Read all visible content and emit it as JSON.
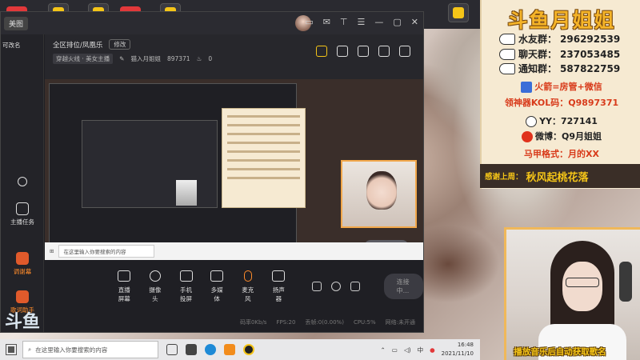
{
  "outer": {
    "top_tab": "美图",
    "left_label": "可改名",
    "sidebar": {
      "host_task": "主播任务",
      "volume_lottery": "调谢幕",
      "song_helper": "歌词助手"
    },
    "logo_text": "斗鱼"
  },
  "window": {
    "room_category": "全区排位/凤凰乐",
    "edit_label": "修改",
    "room_subtitle": "穿越火线 · 美女主播",
    "room_owner": "猫入月姐姐",
    "room_id": "897371",
    "heat": "0",
    "preview_nested_caption": "预览中",
    "start_button": "连接中..."
  },
  "controls": [
    {
      "label": "直播屏幕",
      "icon": "monitor-icon"
    },
    {
      "label": "摄像头",
      "icon": "camera-icon"
    },
    {
      "label": "手机投屏",
      "icon": "phone-icon"
    },
    {
      "label": "多媒体",
      "icon": "media-icon"
    },
    {
      "label": "麦克风",
      "icon": "microphone-icon"
    },
    {
      "label": "扬声器",
      "icon": "speaker-icon"
    }
  ],
  "status": {
    "bitrate": "码率0Kb/s",
    "fps": "FPS:20",
    "drop": "丢帧:0(0.00%)",
    "cpu": "CPU:5%",
    "network": "网络:未开通"
  },
  "taskbar": {
    "search_placeholder": "在这里输入你要搜索的内容",
    "ime": "中",
    "time": "16:48",
    "date": "2021/11/10"
  },
  "info_panel": {
    "title": "斗鱼月姐姐",
    "fan_group_label": "水友群：",
    "fan_group": "296292539",
    "chat_group_label": "聊天群：",
    "chat_group": "237053485",
    "notice_group_label": "通知群：",
    "notice_group": "587822759",
    "rocket_line": "火箭=房管+微信",
    "kol_line": "领神器KOL码：Q9897371",
    "yy_line": "YY：727141",
    "weibo_line": "微博：Q9月姐姐",
    "format_line": "马甲格式：月的XX",
    "thanks_label": "感谢上周：",
    "thanks_name": "秋风起桃花落",
    "caption": "播放音乐后自动获取歌名"
  },
  "colors": {
    "accent_orange": "#ff8c2b",
    "panel_bg": "#f6ead2",
    "title_gold": "#f5b428",
    "red_text": "#d83a1a"
  }
}
